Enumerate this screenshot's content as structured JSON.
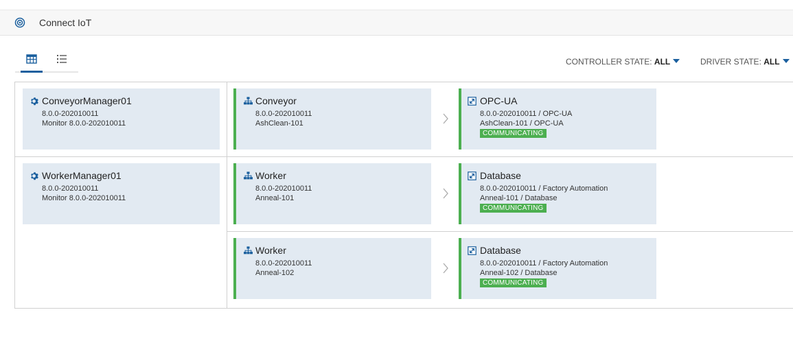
{
  "header": {
    "title": "Connect IoT"
  },
  "toolbar": {
    "filters": [
      {
        "label": "CONTROLLER STATE:",
        "value": "ALL"
      },
      {
        "label": "DRIVER STATE:",
        "value": "ALL"
      }
    ]
  },
  "rows": [
    {
      "manager": {
        "name": "ConveyorManager01",
        "version": "8.0.0-202010011",
        "monitor": "Monitor 8.0.0-202010011"
      },
      "controllers": [
        {
          "name": "Conveyor",
          "version": "8.0.0-202010011",
          "instance": "AshClean-101",
          "driver": {
            "name": "OPC-UA",
            "line1": "8.0.0-202010011  /  OPC-UA",
            "line2": "AshClean-101  /  OPC-UA",
            "state": "COMMUNICATING"
          }
        }
      ]
    },
    {
      "manager": {
        "name": "WorkerManager01",
        "version": "8.0.0-202010011",
        "monitor": "Monitor 8.0.0-202010011"
      },
      "controllers": [
        {
          "name": "Worker",
          "version": "8.0.0-202010011",
          "instance": "Anneal-101",
          "driver": {
            "name": "Database",
            "line1": "8.0.0-202010011  /  Factory Automation",
            "line2": "Anneal-101  /  Database",
            "state": "COMMUNICATING"
          }
        },
        {
          "name": "Worker",
          "version": "8.0.0-202010011",
          "instance": "Anneal-102",
          "driver": {
            "name": "Database",
            "line1": "8.0.0-202010011  /  Factory Automation",
            "line2": "Anneal-102  /  Database",
            "state": "COMMUNICATING"
          }
        }
      ]
    }
  ],
  "colors": {
    "accent": "#4caf50",
    "brand": "#1a5f9e",
    "card": "#e2eaf2"
  }
}
